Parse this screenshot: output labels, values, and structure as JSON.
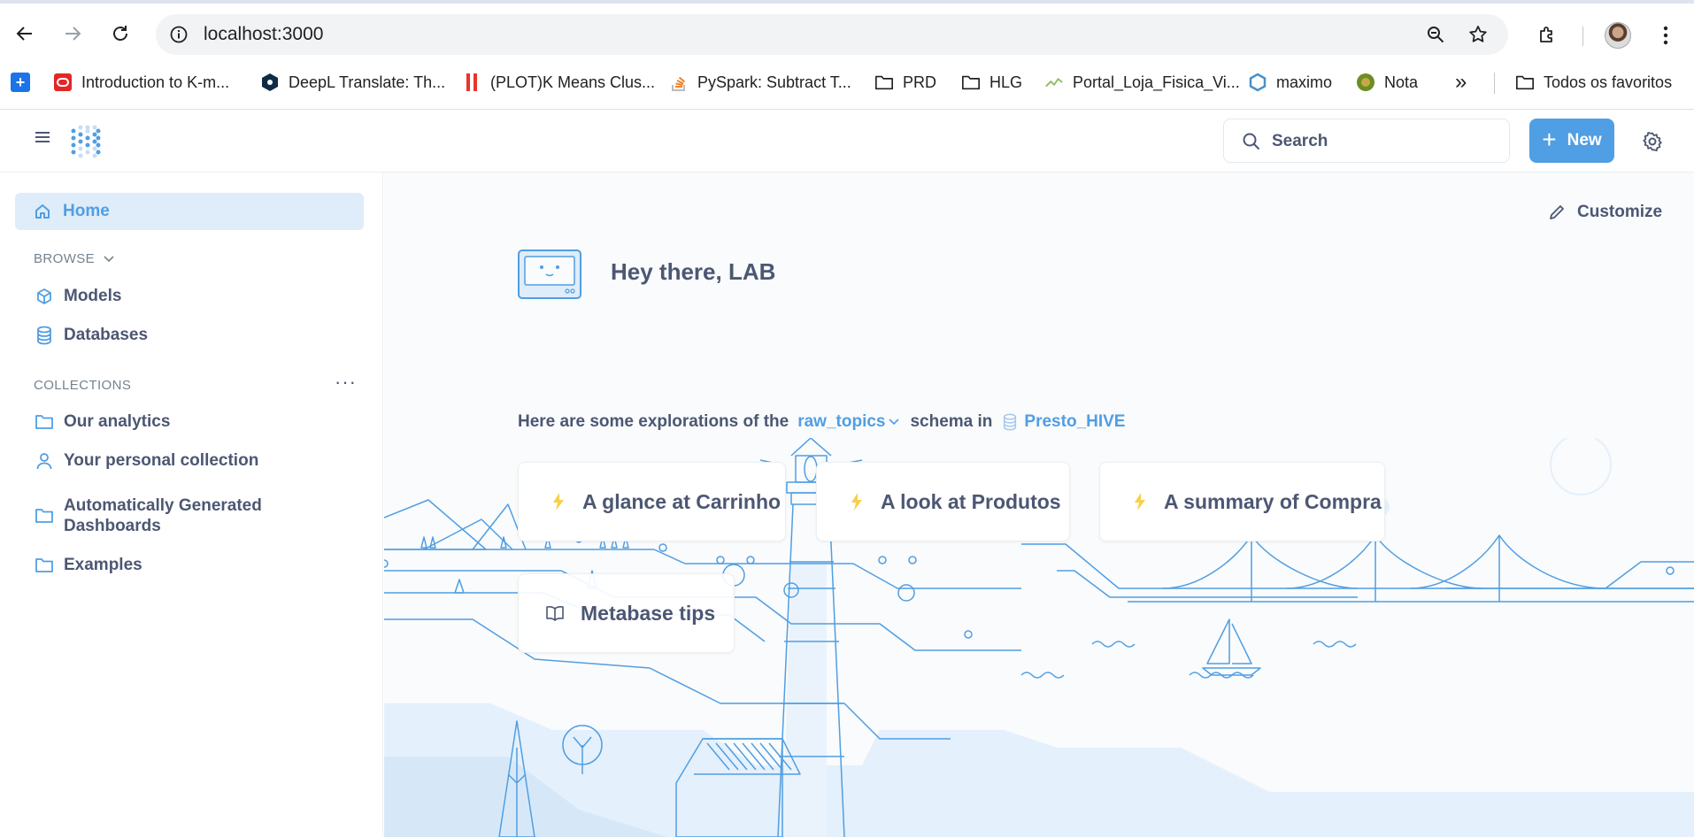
{
  "browser": {
    "url": "localhost:3000",
    "bookmarks": [
      {
        "label": "Introduction to K-m...",
        "icon": "oracle-icon"
      },
      {
        "label": "DeepL Translate: Th...",
        "icon": "deepl-icon"
      },
      {
        "label": "(PLOT)K Means Clus...",
        "icon": "plot-icon"
      },
      {
        "label": "PySpark: Subtract T...",
        "icon": "stackoverflow-icon"
      },
      {
        "label": "PRD",
        "icon": "folder-icon"
      },
      {
        "label": "HLG",
        "icon": "folder-icon"
      },
      {
        "label": "Portal_Loja_Fisica_Vi...",
        "icon": "chart-icon"
      },
      {
        "label": "maximo",
        "icon": "maximo-icon"
      },
      {
        "label": "Nota",
        "icon": "nota-icon"
      }
    ],
    "all_bookmarks": "Todos os favoritos"
  },
  "header": {
    "search_label": "Search",
    "new_label": "New"
  },
  "sidebar": {
    "home": "Home",
    "browse_heading": "BROWSE",
    "browse_items": [
      "Models",
      "Databases"
    ],
    "collections_heading": "COLLECTIONS",
    "collections": [
      "Our analytics",
      "Your personal collection",
      "Automatically Generated Dashboards",
      "Examples"
    ]
  },
  "main": {
    "customize": "Customize",
    "greeting": "Hey there, LAB",
    "explore_prefix": "Here are some explorations of the",
    "schema": "raw_topics",
    "explore_mid": "schema in",
    "database": "Presto_HIVE",
    "cards": [
      "A glance at Carrinho",
      "A look at Produtos",
      "A summary of Compra"
    ],
    "tips": "Metabase tips"
  },
  "colors": {
    "brand": "#509ee3",
    "text": "#4c5773",
    "lightning": "#f9cf48",
    "home_bg": "#dfecf9"
  }
}
